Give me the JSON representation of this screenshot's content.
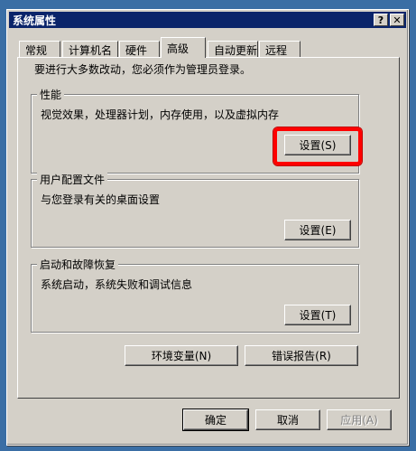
{
  "window": {
    "title": "系统属性",
    "help_glyph": "?",
    "close_glyph": "✕"
  },
  "tabs": [
    "常规",
    "计算机名",
    "硬件",
    "高级",
    "自动更新",
    "远程"
  ],
  "active_tab": "高级",
  "intro": "要进行大多数改动，您必须作为管理员登录。",
  "groups": {
    "performance": {
      "title": "性能",
      "desc": "视觉效果，处理器计划，内存使用，以及虚拟内存",
      "button": "设置(S)"
    },
    "user_profiles": {
      "title": "用户配置文件",
      "desc": "与您登录有关的桌面设置",
      "button": "设置(E)"
    },
    "startup": {
      "title": "启动和故障恢复",
      "desc": "系统启动，系统失败和调试信息",
      "button": "设置(T)"
    }
  },
  "env_button": "环境变量(N)",
  "error_report_button": "错误报告(R)",
  "footer": {
    "ok": "确定",
    "cancel": "取消",
    "apply": "应用(A)"
  },
  "highlight_color": "#ff0000"
}
